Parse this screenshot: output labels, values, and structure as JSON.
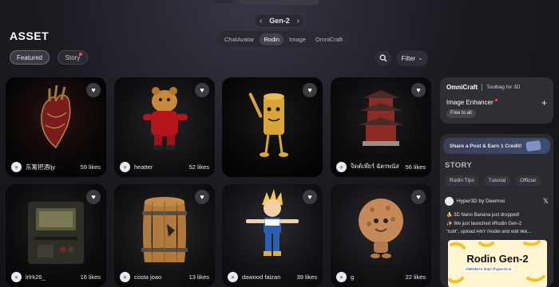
{
  "header": {
    "gen_label": "Gen-2",
    "model_tabs": [
      "ChatAvatar",
      "Rodin",
      "Image",
      "OmniCraft"
    ],
    "active_model": "Rodin"
  },
  "page": {
    "title": "ASSET",
    "chips": {
      "featured": "Featured",
      "story": "Story"
    },
    "filter_label": "Filter"
  },
  "cards": [
    {
      "user": "东篱把酒ljy",
      "likes": "59 likes",
      "subject": "anatomical heart"
    },
    {
      "user": "heatter",
      "likes": "52 likes",
      "subject": "bear in red sweater"
    },
    {
      "user": "",
      "likes": "",
      "subject": "cylinder character with bat"
    },
    {
      "user": "จิดต์เพ๊ยร์ ฉัตรพนัส",
      "likes": "56 likes",
      "subject": "chinese pagoda"
    },
    {
      "user": "lrlrk26_",
      "likes": "16 likes",
      "subject": "old tv machine"
    },
    {
      "user": "costa joao",
      "likes": "13 likes",
      "subject": "wooden barrel"
    },
    {
      "user": "dawood faizan",
      "likes": "39 likes",
      "subject": "anime boy"
    },
    {
      "user": "g",
      "likes": "22 likes",
      "subject": "cookie character"
    }
  ],
  "sidebar": {
    "omnicraft": {
      "title": "OmniCraft",
      "subtitle": "Toolbag for 3D",
      "feature": "Image Enhancer",
      "badge": "Free to all"
    },
    "share_banner": "Share a Post & Earn 1 Credit!",
    "story_title": "STORY",
    "story_tabs": [
      "Rodin Tips",
      "Tutorial",
      "Official"
    ],
    "post": {
      "author": "Hyper3D by Deemos",
      "lines": [
        "🍌 3D Nano Banana just dropped!",
        "✨ We just launched #Rodin Gen-2",
        "\"Edit\", upload ANY model and edit like..."
      ],
      "image_title": "Rodin Gen-2",
      "image_sub": "OMNIMAX https://hyper3d.ai"
    }
  },
  "colors": {
    "accent_red": "#ff4d5a",
    "panel": "#2a2a30",
    "bg": "#1c1b22"
  },
  "icons": [
    "search-icon",
    "chevron-down-icon",
    "heart-icon",
    "user-icon",
    "plus-icon",
    "x-logo-icon",
    "chevron-left-icon",
    "chevron-right-icon"
  ]
}
